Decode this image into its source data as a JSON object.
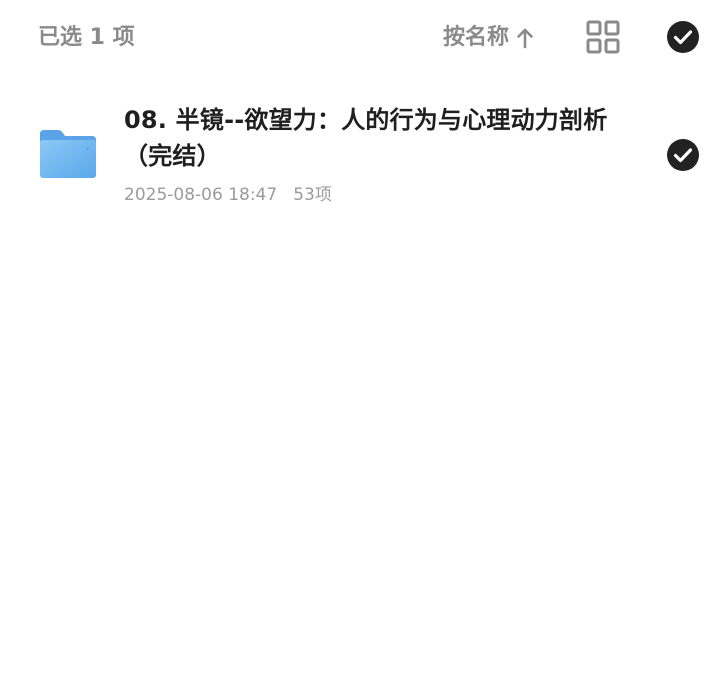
{
  "header": {
    "selection_count": "已选 1 项",
    "sort_label": "按名称",
    "sort_direction_icon": "arrow-up-icon",
    "view_toggle_icon": "grid-icon",
    "select_all_icon": "check-circle-icon"
  },
  "files": [
    {
      "icon": "folder-icon",
      "name": "08. 半镜--欲望力：人的行为与心理动力剖析（完结）",
      "date": "2025-08-06 18:47",
      "count": "53项",
      "selected": true
    }
  ],
  "colors": {
    "muted_text": "#8a8a8a",
    "primary_text": "#1f1f1f",
    "check_fill": "#222222",
    "folder_blue": "#6bb3f0"
  }
}
